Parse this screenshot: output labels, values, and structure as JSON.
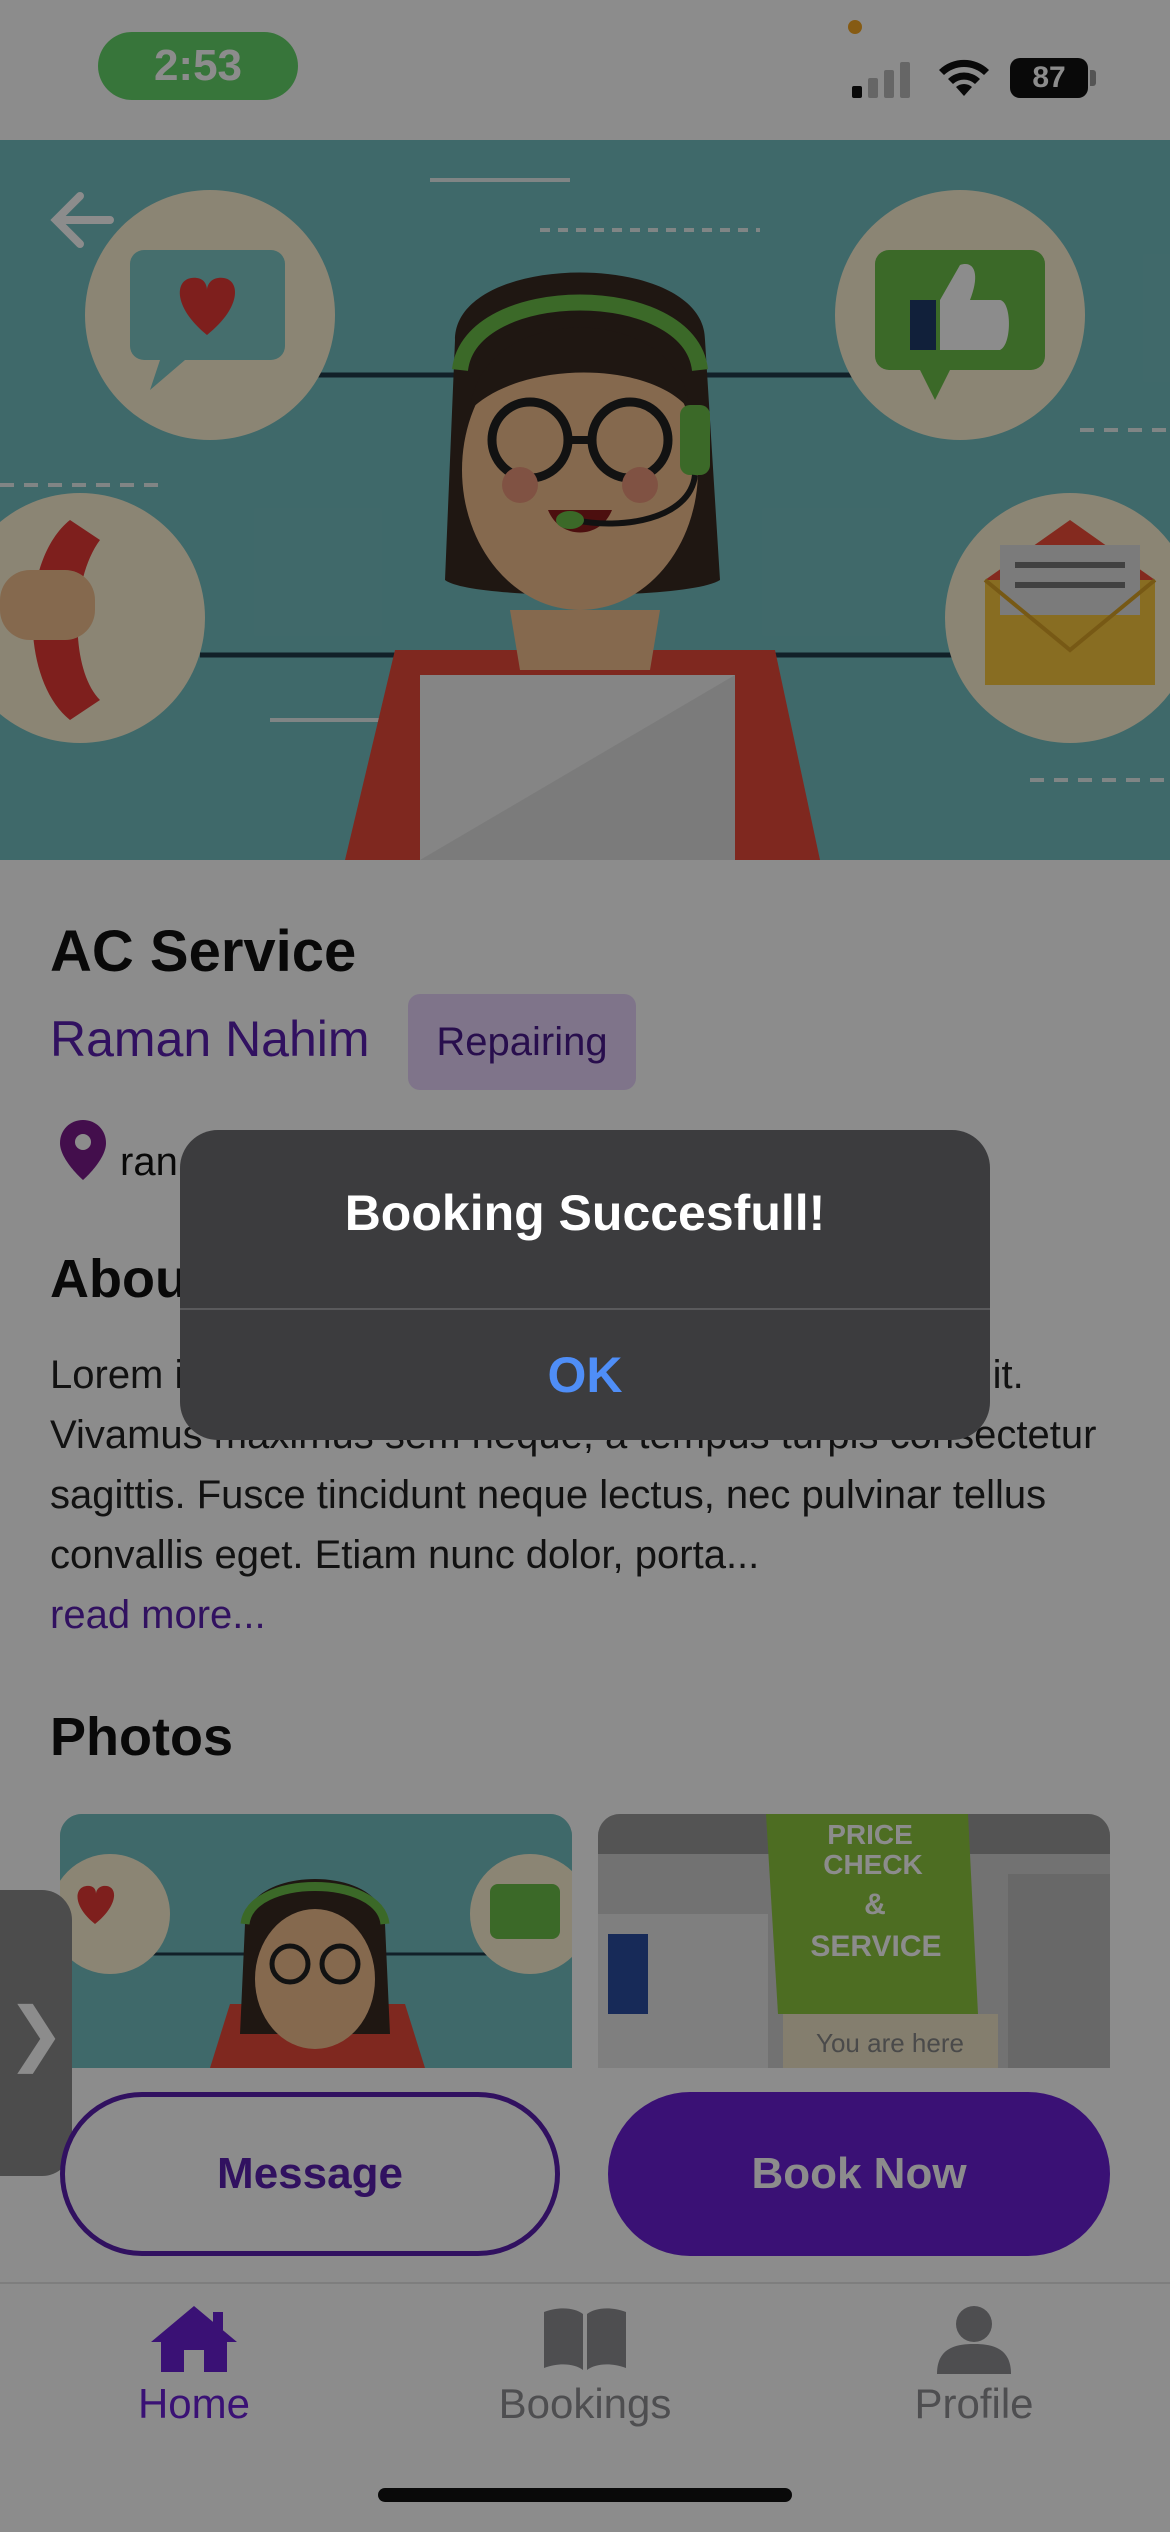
{
  "status_bar": {
    "time": "2:53",
    "battery": "87"
  },
  "service": {
    "title": "AC Service",
    "provider": "Raman Nahim",
    "category": "Repairing",
    "location": "ran"
  },
  "about": {
    "heading": "About",
    "text": "Lorem ipsum dolor sit amet, consectetur adipiscing elit. Vivamus maximus sem neque, a tempus turpis consectetur sagittis. Fusce tincidunt neque lectus, nec pulvinar tellus convallis eget. Etiam nunc dolor, porta...",
    "read_more": "read more..."
  },
  "photos": {
    "heading": "Photos",
    "photo2_sign": [
      "PRICE",
      "CHECK",
      "&",
      "SERVICE"
    ],
    "photo2_banner": "You are here"
  },
  "side_handle": {
    "icon": "chevron-right-icon",
    "glyph": "❯"
  },
  "actions": {
    "message_label": "Message",
    "book_label": "Book Now"
  },
  "tabs": [
    {
      "label": "Home",
      "icon": "home-icon",
      "active": true
    },
    {
      "label": "Bookings",
      "icon": "book-icon",
      "active": false
    },
    {
      "label": "Profile",
      "icon": "person-icon",
      "active": false
    }
  ],
  "alert": {
    "title": "Booking Succesfull!",
    "ok_label": "OK"
  },
  "colors": {
    "accent": "#6a1fd6",
    "badge_bg": "#e7d4fb",
    "alert_bg": "#3c3c3e",
    "alert_button": "#4f8ef7"
  }
}
